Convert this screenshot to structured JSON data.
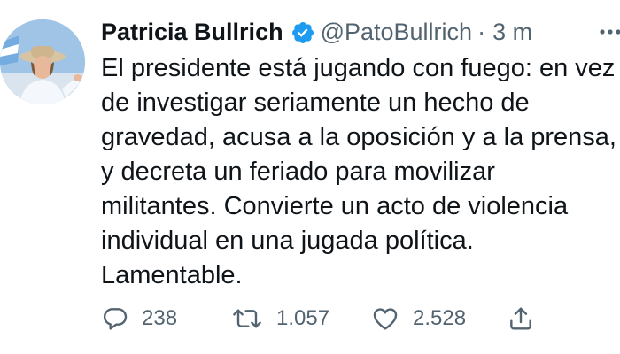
{
  "tweet": {
    "author": {
      "name": "Patricia Bullrich",
      "handle": "@PatoBullrich",
      "verified": true,
      "avatar_icon": "profile-photo"
    },
    "separator": "·",
    "time": "3 m",
    "text_lines": [
      "El presidente está jugando con fuego: en vez",
      "de investigar seriamente un hecho de",
      "gravedad, acusa a la oposición y a la prensa,",
      "y decreta un feriado para movilizar",
      "militantes. Convierte un acto de violencia",
      "individual en una jugada política.",
      "Lamentable."
    ],
    "actions": {
      "replies": "238",
      "retweets": "1.057",
      "likes": "2.528"
    },
    "icons": {
      "verified": "verified-badge-icon",
      "more": "more-options-icon",
      "reply": "reply-icon",
      "retweet": "retweet-icon",
      "like": "heart-icon",
      "share": "share-icon"
    },
    "colors": {
      "text": "#0f1419",
      "secondary": "#536471",
      "verified": "#1d9bf0"
    }
  }
}
